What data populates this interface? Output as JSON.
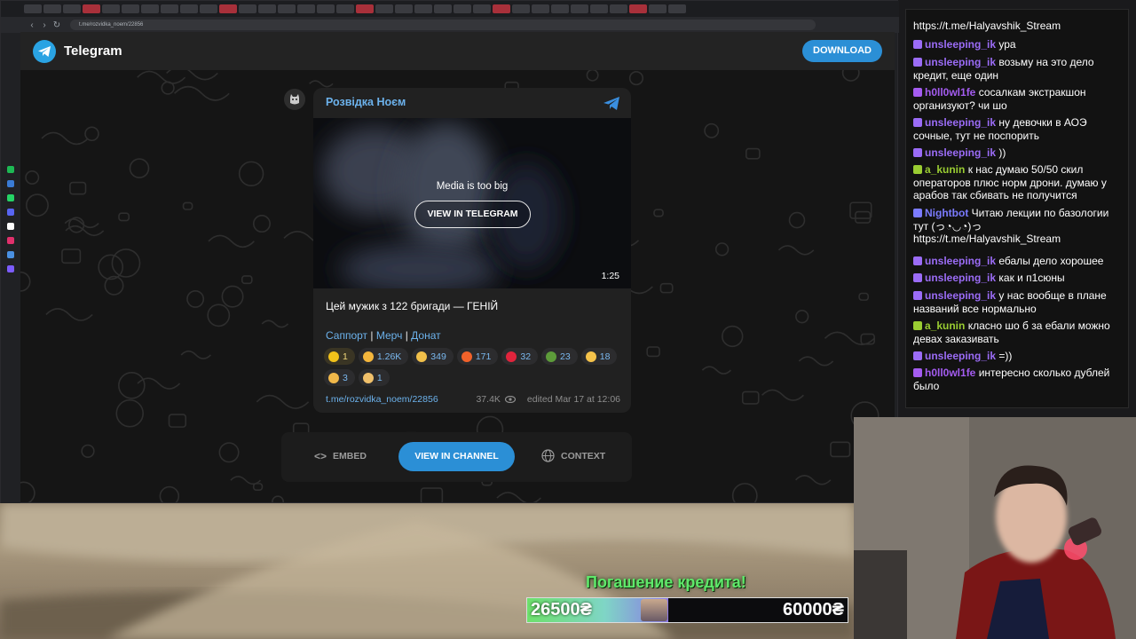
{
  "browser": {
    "url": "t.me/rozvidka_noem/22856"
  },
  "header": {
    "app_title": "Telegram",
    "download_label": "DOWNLOAD"
  },
  "post": {
    "channel_name": "Розвідка Ноєм",
    "media_notice": "Media is too big",
    "media_button": "VIEW IN TELEGRAM",
    "duration": "1:25",
    "text": "Цей мужик з 122 бригади — ГЕНІЙ",
    "links": [
      "Саппорт",
      "Мерч",
      "Донат"
    ],
    "link_separator": "|",
    "reactions": [
      {
        "emoji": "star",
        "count": "1",
        "active": true
      },
      {
        "emoji": "smile-face",
        "count": "1.26K"
      },
      {
        "emoji": "thumbs-up",
        "count": "349"
      },
      {
        "emoji": "fire",
        "count": "171"
      },
      {
        "emoji": "heart",
        "count": "32"
      },
      {
        "emoji": "frog",
        "count": "23"
      },
      {
        "emoji": "grin-face",
        "count": "18"
      },
      {
        "emoji": "shout-hand",
        "count": "3"
      },
      {
        "emoji": "middle-finger",
        "count": "1"
      }
    ],
    "url": "t.me/rozvidka_noem/22856",
    "views": "37.4K",
    "edited": "edited  Mar 17 at 12:06"
  },
  "actions": {
    "embed": "EMBED",
    "view_in_channel": "VIEW IN CHANNEL",
    "context": "CONTEXT"
  },
  "chat": [
    {
      "user": "",
      "text": "https://t.me/Halyavshik_Stream",
      "color": "#ffffff"
    },
    {
      "user": "unsleeping_ik",
      "text": "ура",
      "color": "#9b6cf6"
    },
    {
      "user": "unsleeping_ik",
      "text": "возьму на это дело кредит, еще один",
      "color": "#9b6cf6"
    },
    {
      "user": "h0ll0wl1fe",
      "text": "сосалкам экстракшон организуют? чи шо",
      "color": "#a45cf0"
    },
    {
      "user": "unsleeping_ik",
      "text": "ну девочки в АОЭ сочные, тут не поспорить",
      "color": "#9b6cf6"
    },
    {
      "user": "unsleeping_ik",
      "text": "))",
      "color": "#9b6cf6"
    },
    {
      "user": "a_kunin",
      "text": "к нас думаю 50/50 скил операторов плюс норм дрони. думаю у арабов так сбивать не получится",
      "color": "#9acd32"
    },
    {
      "user": "Nightbot",
      "text": "Читаю лекции по базологии тут (っ◔◡◔)っ https://t.me/Halyavshik_Stream",
      "color": "#7b7bff"
    },
    {
      "user": "unsleeping_ik",
      "text": "ебалы дело хорошее",
      "color": "#9b6cf6"
    },
    {
      "user": "unsleeping_ik",
      "text": "как и п1сюны",
      "color": "#9b6cf6"
    },
    {
      "user": "unsleeping_ik",
      "text": "у нас вообще в плане названий все нормально",
      "color": "#9b6cf6"
    },
    {
      "user": "a_kunin",
      "text": "класно шо б за ебали можно девах заказивать",
      "color": "#9acd32"
    },
    {
      "user": "unsleeping_ik",
      "text": "=))",
      "color": "#9b6cf6"
    },
    {
      "user": "h0ll0wl1fe",
      "text": "интересно сколько дублей было",
      "color": "#a45cf0"
    }
  ],
  "donation": {
    "title": "Погашение кредита!",
    "current": "26500₴",
    "goal": "60000₴",
    "progress": 0.4417
  }
}
